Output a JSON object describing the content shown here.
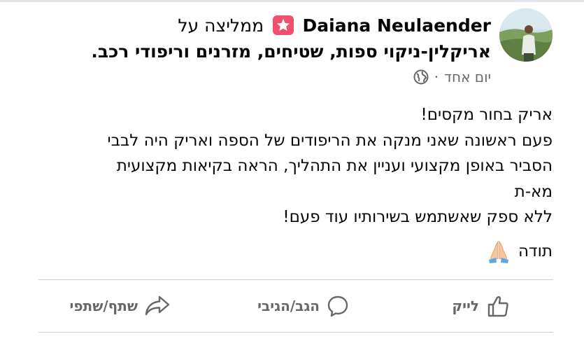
{
  "post": {
    "author_name": "Daiana Neulaender",
    "recommends_text": "ממליצה על",
    "page_name": "אריקלין-ניקוי ספות, שטיחים, מזרנים וריפודי רכב.",
    "timestamp": "יום אחד",
    "separator": "·",
    "privacy_icon": "globe-icon",
    "body_lines": [
      "אריק בחור מקסים!",
      "פעם ראשונה שאני מנקה את הריפודים של הספה ואריק היה לבבי",
      "הסביר באופן מקצועי ועניין את התהליך, הראה בקיאות מקצועית",
      "מא-ת",
      "ללא ספק שאשתמש בשירותיו עוד פעם!"
    ],
    "thanks_text": "תודה",
    "thanks_icon": "folded-hands-icon"
  },
  "actions": {
    "like_label": "לייק",
    "comment_label": "הגב/הגיבי",
    "share_label": "שתף/שתפי"
  },
  "colors": {
    "recommend_badge": "#f0506e",
    "secondary_text": "#65676b",
    "divider": "#ced0d4"
  }
}
